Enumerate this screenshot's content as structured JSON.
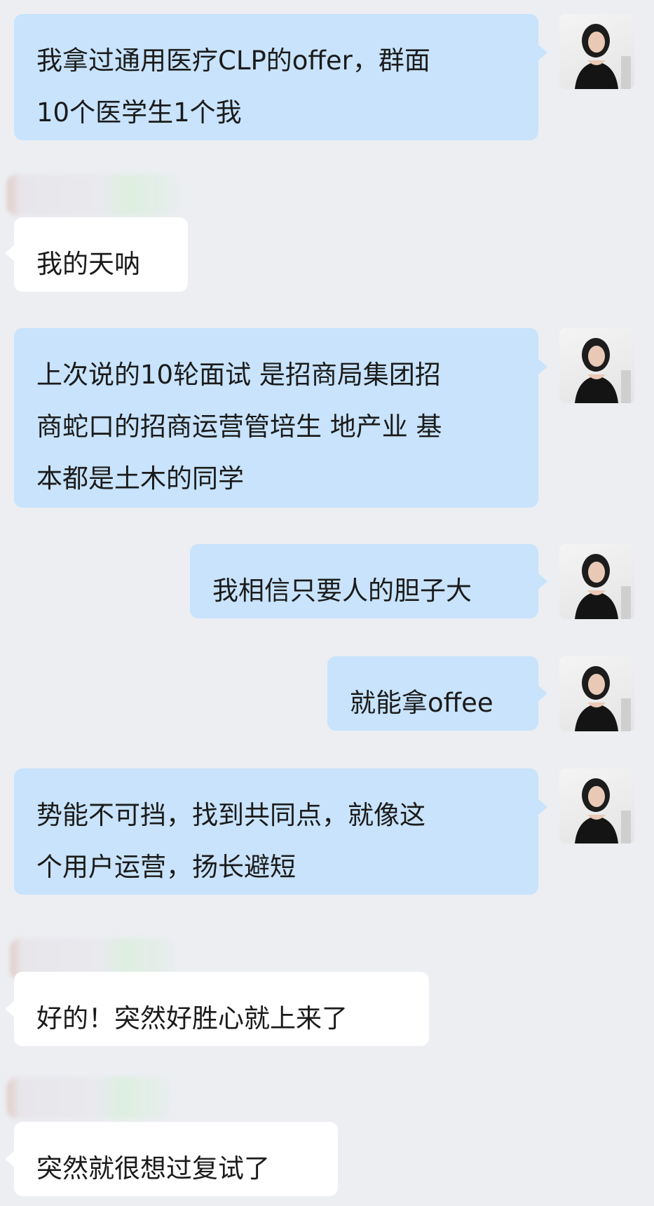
{
  "messages": [
    {
      "side": "out",
      "text": "我拿过通用医疗CLP的offer，群面\n10个医学生1个我"
    },
    {
      "side": "in",
      "text": "我的天呐"
    },
    {
      "side": "out",
      "text": "上次说的10轮面试 是招商局集团招\n商蛇口的招商运营管培生 地产业 基\n本都是土木的同学"
    },
    {
      "side": "out",
      "text": "我相信只要人的胆子大"
    },
    {
      "side": "out",
      "text": "就能拿offee"
    },
    {
      "side": "out",
      "text": "势能不可挡，找到共同点，就像这\n个用户运营，扬长避短"
    },
    {
      "side": "in",
      "text": "好的！突然好胜心就上来了"
    },
    {
      "side": "in",
      "text": "突然就很想过复试了"
    }
  ],
  "colors": {
    "background": "#eceef2",
    "outgoing_bubble": "#c8e3fb",
    "incoming_bubble": "#ffffff",
    "text": "#1b1b1b"
  },
  "icons": {
    "self_avatar": "profile-photo-icon",
    "contact_name": "blurred-name"
  }
}
